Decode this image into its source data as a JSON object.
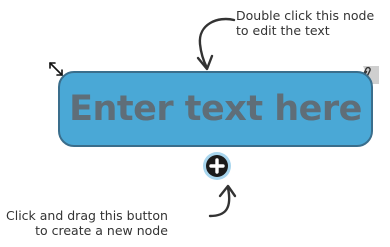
{
  "node": {
    "text": "Enter text here",
    "fill_color": "#4aa8d6",
    "border_color": "#3a6e8c"
  },
  "hints": {
    "edit": [
      "Double click this node",
      "to edit the text"
    ],
    "add": [
      "Click and drag this button",
      "to create a new node"
    ]
  },
  "icons": {
    "resize": "resize-arrows-icon",
    "attach": "paperclip-icon",
    "add": "plus-circle-icon"
  }
}
